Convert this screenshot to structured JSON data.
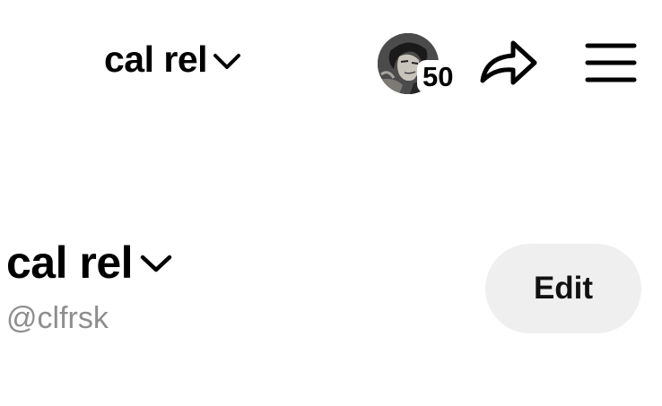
{
  "header": {
    "title": "cal rel",
    "notification_count": "50",
    "icons": {
      "title_dropdown": "chevron-down-icon",
      "avatar": "avatar",
      "share": "share-arrow-icon",
      "menu": "hamburger-menu-icon"
    }
  },
  "profile": {
    "name": "cal rel",
    "handle": "@clfrsk",
    "edit_label": "Edit"
  },
  "colors": {
    "text": "#000000",
    "handle": "#8e8e8e",
    "edit_button_bg": "#efefef",
    "background": "#ffffff"
  }
}
